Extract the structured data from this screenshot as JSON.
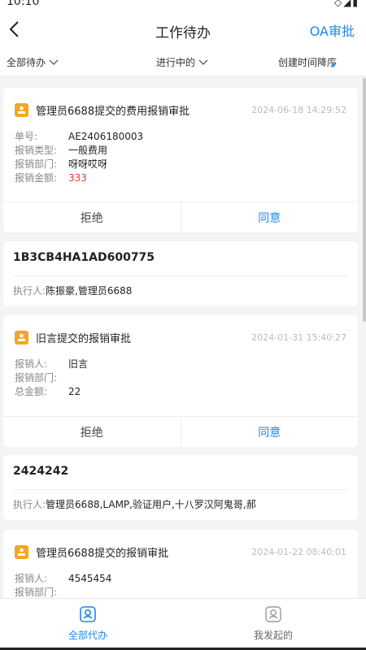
{
  "status": {
    "time": "10:10"
  },
  "header": {
    "title": "工作待办",
    "action": "OA审批"
  },
  "filters": {
    "scope": "全部待办",
    "state": "进行中的",
    "sort": "创建时间降序"
  },
  "cards": [
    {
      "title": "管理员6688提交的费用报销审批",
      "time": "2024-06-18 14:29:52",
      "fields": [
        {
          "label": "单号:",
          "value": "AE2406180003"
        },
        {
          "label": "报销类型:",
          "value": "一般费用"
        },
        {
          "label": "报销部门:",
          "value": "呀呀哎呀"
        },
        {
          "label": "报销金额:",
          "value": "333"
        }
      ],
      "reject": "拒绝",
      "agree": "同意"
    },
    {
      "title": "旧言提交的报销审批",
      "time": "2024-01-31 15:40:27",
      "fields": [
        {
          "label": "报销人:",
          "value": "旧言"
        },
        {
          "label": "报销部门:",
          "value": ""
        },
        {
          "label": "总金额:",
          "value": "22"
        }
      ],
      "reject": "拒绝",
      "agree": "同意"
    },
    {
      "title": "管理员6688提交的报销审批",
      "time": "2024-01-22 08:40:01",
      "fields": [
        {
          "label": "报销人:",
          "value": "4545454"
        },
        {
          "label": "报销部门:",
          "value": ""
        }
      ]
    }
  ],
  "tasks": [
    {
      "title": "1B3CB4HA1AD600775",
      "exec_label": "执行人:",
      "exec_value": "陈振豪,管理员6688"
    },
    {
      "title": "2424242",
      "exec_label": "执行人:",
      "exec_value": "管理员6688,LAMP,验证用户,十八罗汉阿鬼哥,郝"
    }
  ],
  "tabs": {
    "all": "全部代办",
    "mine": "我发起的"
  },
  "colors": {
    "accent": "#1e88e5",
    "avatar": "#f5a623",
    "amount": "#e53935"
  }
}
